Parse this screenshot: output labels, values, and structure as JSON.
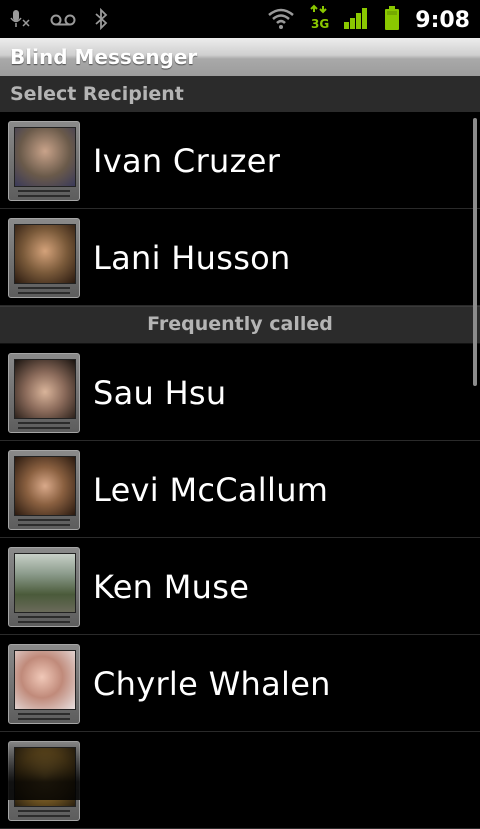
{
  "status_bar": {
    "time": "9:08",
    "icons": [
      "mic-muted-icon",
      "voicemail-icon",
      "bluetooth-icon",
      "wifi-icon",
      "3g-data-icon",
      "signal-icon",
      "battery-icon"
    ],
    "network_label": "3G",
    "accent_color": "#8ac800"
  },
  "app": {
    "title": "Blind Messenger"
  },
  "recipient_section": {
    "header": "Select Recipient"
  },
  "contacts": [
    {
      "name": "Ivan Cruzer",
      "avatar_color": "#6a5a4a"
    },
    {
      "name": "Lani Husson",
      "avatar_color": "#7a5a3a"
    }
  ],
  "frequent_section": {
    "header": "Frequently called"
  },
  "frequent_contacts": [
    {
      "name": "Sau Hsu",
      "avatar_color": "#5a4030"
    },
    {
      "name": "Levi McCallum",
      "avatar_color": "#4a3a2a"
    },
    {
      "name": "Ken Muse",
      "avatar_color": "#5a6a5a"
    },
    {
      "name": "Chyrle Whalen",
      "avatar_color": "#c08a7a"
    },
    {
      "name": "",
      "avatar_color": "#6a5020"
    }
  ]
}
